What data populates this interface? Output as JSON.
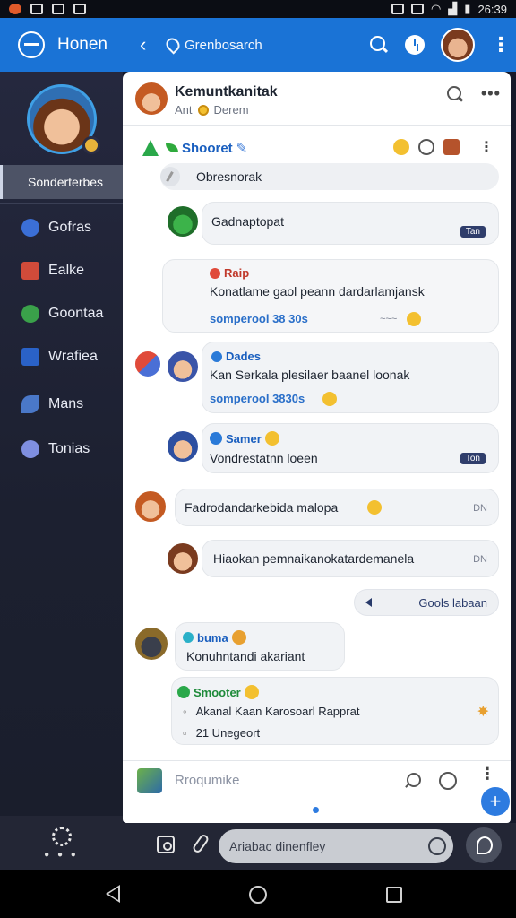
{
  "status_bar": {
    "time": "26:39"
  },
  "app_bar": {
    "title": "Honen",
    "breadcrumb": "Grenbosarch",
    "accent": "#1a73d6"
  },
  "sidebar": {
    "active_item": "Sonderterbes",
    "items": [
      {
        "label": "Gofras",
        "icon": "planet-icon",
        "color": "#3b6fd6"
      },
      {
        "label": "Ealke",
        "icon": "blocks-icon",
        "color": "#d14b3a"
      },
      {
        "label": "Goontaa",
        "icon": "globe-icon",
        "color": "#3aa14a"
      },
      {
        "label": "Wrafiea",
        "icon": "check-icon",
        "color": "#2a62c8"
      },
      {
        "label": "Mans",
        "icon": "leaf-icon",
        "color": "#4a78c8"
      },
      {
        "label": "Tonias",
        "icon": "star-icon",
        "color": "#7f8fe0"
      }
    ]
  },
  "chat": {
    "header": {
      "title": "Kemuntkanitak",
      "status": "Ant",
      "subtitle": "Derem"
    },
    "thread": {
      "name": "Shooret"
    },
    "pinned": "Obresnorak",
    "messages": [
      {
        "sender": "",
        "text": "Gadnaptopat",
        "badge": "Tan"
      },
      {
        "sender": "Raip",
        "text": "Konatlame gaol peann dardarlamjansk",
        "meta": "somperool 38 30s",
        "time": "~~~"
      },
      {
        "sender": "Dades",
        "text": "Kan Serkala plesilaer baanel loonak",
        "meta": "somperool 3830s"
      },
      {
        "sender": "Samer",
        "text": "Vondrestatnn loeen",
        "badge": "Ton"
      },
      {
        "sender": "",
        "text": "Fadrodandarkebida malopa",
        "time": "DN"
      },
      {
        "sender": "",
        "text": "Hiaokan pemnaikanokatardemanela",
        "time": "DN"
      },
      {
        "sender": "",
        "text": "Gools labaan",
        "type": "reply"
      },
      {
        "sender": "buma",
        "text": "Konuhntandi akariant"
      },
      {
        "sender": "Smooter",
        "line1": "Akanal Kaan Karosoarl Rapprat",
        "line2": "21 Unegeort"
      }
    ],
    "composer_placeholder": "Rroqumike"
  },
  "bottom_bar": {
    "input_value": "Ariabac dinenfley"
  }
}
